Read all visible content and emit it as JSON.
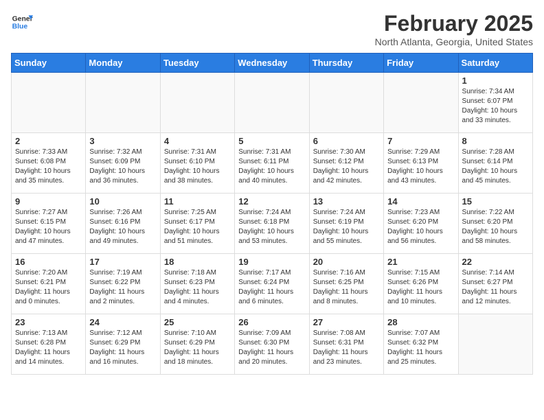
{
  "header": {
    "logo_line1": "General",
    "logo_line2": "Blue",
    "month_year": "February 2025",
    "location": "North Atlanta, Georgia, United States"
  },
  "weekdays": [
    "Sunday",
    "Monday",
    "Tuesday",
    "Wednesday",
    "Thursday",
    "Friday",
    "Saturday"
  ],
  "weeks": [
    [
      {
        "day": "",
        "info": ""
      },
      {
        "day": "",
        "info": ""
      },
      {
        "day": "",
        "info": ""
      },
      {
        "day": "",
        "info": ""
      },
      {
        "day": "",
        "info": ""
      },
      {
        "day": "",
        "info": ""
      },
      {
        "day": "1",
        "info": "Sunrise: 7:34 AM\nSunset: 6:07 PM\nDaylight: 10 hours\nand 33 minutes."
      }
    ],
    [
      {
        "day": "2",
        "info": "Sunrise: 7:33 AM\nSunset: 6:08 PM\nDaylight: 10 hours\nand 35 minutes."
      },
      {
        "day": "3",
        "info": "Sunrise: 7:32 AM\nSunset: 6:09 PM\nDaylight: 10 hours\nand 36 minutes."
      },
      {
        "day": "4",
        "info": "Sunrise: 7:31 AM\nSunset: 6:10 PM\nDaylight: 10 hours\nand 38 minutes."
      },
      {
        "day": "5",
        "info": "Sunrise: 7:31 AM\nSunset: 6:11 PM\nDaylight: 10 hours\nand 40 minutes."
      },
      {
        "day": "6",
        "info": "Sunrise: 7:30 AM\nSunset: 6:12 PM\nDaylight: 10 hours\nand 42 minutes."
      },
      {
        "day": "7",
        "info": "Sunrise: 7:29 AM\nSunset: 6:13 PM\nDaylight: 10 hours\nand 43 minutes."
      },
      {
        "day": "8",
        "info": "Sunrise: 7:28 AM\nSunset: 6:14 PM\nDaylight: 10 hours\nand 45 minutes."
      }
    ],
    [
      {
        "day": "9",
        "info": "Sunrise: 7:27 AM\nSunset: 6:15 PM\nDaylight: 10 hours\nand 47 minutes."
      },
      {
        "day": "10",
        "info": "Sunrise: 7:26 AM\nSunset: 6:16 PM\nDaylight: 10 hours\nand 49 minutes."
      },
      {
        "day": "11",
        "info": "Sunrise: 7:25 AM\nSunset: 6:17 PM\nDaylight: 10 hours\nand 51 minutes."
      },
      {
        "day": "12",
        "info": "Sunrise: 7:24 AM\nSunset: 6:18 PM\nDaylight: 10 hours\nand 53 minutes."
      },
      {
        "day": "13",
        "info": "Sunrise: 7:24 AM\nSunset: 6:19 PM\nDaylight: 10 hours\nand 55 minutes."
      },
      {
        "day": "14",
        "info": "Sunrise: 7:23 AM\nSunset: 6:20 PM\nDaylight: 10 hours\nand 56 minutes."
      },
      {
        "day": "15",
        "info": "Sunrise: 7:22 AM\nSunset: 6:20 PM\nDaylight: 10 hours\nand 58 minutes."
      }
    ],
    [
      {
        "day": "16",
        "info": "Sunrise: 7:20 AM\nSunset: 6:21 PM\nDaylight: 11 hours\nand 0 minutes."
      },
      {
        "day": "17",
        "info": "Sunrise: 7:19 AM\nSunset: 6:22 PM\nDaylight: 11 hours\nand 2 minutes."
      },
      {
        "day": "18",
        "info": "Sunrise: 7:18 AM\nSunset: 6:23 PM\nDaylight: 11 hours\nand 4 minutes."
      },
      {
        "day": "19",
        "info": "Sunrise: 7:17 AM\nSunset: 6:24 PM\nDaylight: 11 hours\nand 6 minutes."
      },
      {
        "day": "20",
        "info": "Sunrise: 7:16 AM\nSunset: 6:25 PM\nDaylight: 11 hours\nand 8 minutes."
      },
      {
        "day": "21",
        "info": "Sunrise: 7:15 AM\nSunset: 6:26 PM\nDaylight: 11 hours\nand 10 minutes."
      },
      {
        "day": "22",
        "info": "Sunrise: 7:14 AM\nSunset: 6:27 PM\nDaylight: 11 hours\nand 12 minutes."
      }
    ],
    [
      {
        "day": "23",
        "info": "Sunrise: 7:13 AM\nSunset: 6:28 PM\nDaylight: 11 hours\nand 14 minutes."
      },
      {
        "day": "24",
        "info": "Sunrise: 7:12 AM\nSunset: 6:29 PM\nDaylight: 11 hours\nand 16 minutes."
      },
      {
        "day": "25",
        "info": "Sunrise: 7:10 AM\nSunset: 6:29 PM\nDaylight: 11 hours\nand 18 minutes."
      },
      {
        "day": "26",
        "info": "Sunrise: 7:09 AM\nSunset: 6:30 PM\nDaylight: 11 hours\nand 20 minutes."
      },
      {
        "day": "27",
        "info": "Sunrise: 7:08 AM\nSunset: 6:31 PM\nDaylight: 11 hours\nand 23 minutes."
      },
      {
        "day": "28",
        "info": "Sunrise: 7:07 AM\nSunset: 6:32 PM\nDaylight: 11 hours\nand 25 minutes."
      },
      {
        "day": "",
        "info": ""
      }
    ]
  ]
}
